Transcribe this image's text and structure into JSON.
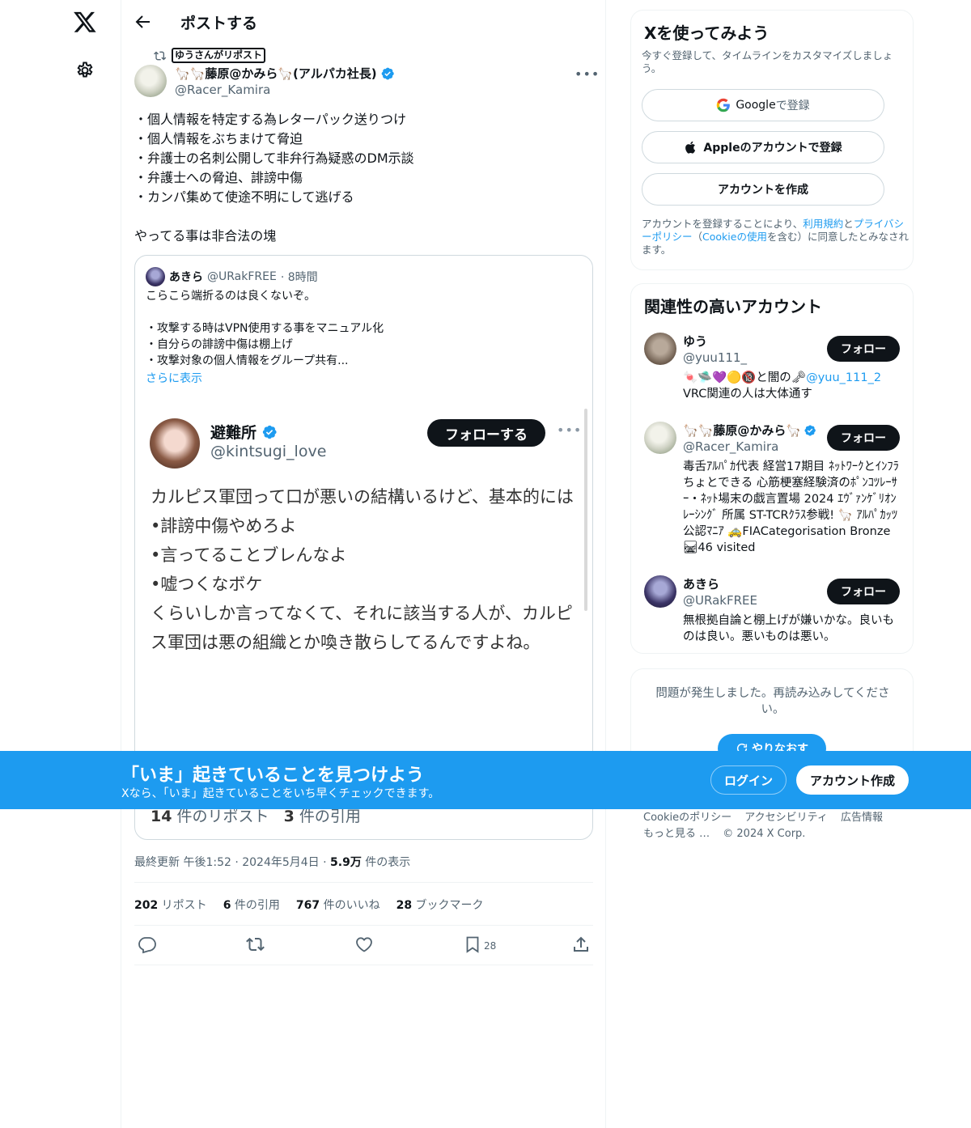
{
  "header": {
    "title": "ポストする"
  },
  "post": {
    "repost_label": "ゆうさんがリポスト",
    "author_name": "🦙🦙藤原@かみら🦙(アルパカ社長)",
    "author_handle": "@Racer_Kamira",
    "more": "•••",
    "body": "・個人情報を特定する為レターパック送りつけ\n・個人情報をぶちまけて脅迫\n・弁護士の名刺公開して非弁行為疑惑のDM示談\n・弁護士への脅迫、誹謗中傷\n・カンパ集めて使途不明にして逃げる\n\nやってる事は非合法の塊",
    "quote": {
      "name": "あきら",
      "handle": "@URakFREE",
      "time": "· 8時間",
      "text": "こらこら端折るのは良くないぞ。\n\n・攻撃する時はVPN使用する事をマニュアル化\n・自分らの誹謗中傷は棚上げ\n・攻撃対象の個人情報をグループ共有...",
      "show_more": "さらに表示",
      "image": {
        "name": "避難所",
        "handle": "@kintsugi_love",
        "follow": "フォローする",
        "dots": "•••",
        "text": "カルピス軍団って口が悪いの結構いるけど、基本的には\n•誹謗中傷やめろよ\n•言ってることブレんなよ\n•嘘つくなボケ\nくらいしか言ってなくて、それに該当する人が、カルピス軍団は悪の組織とか喚き散らしてるんですよね。",
        "reposts_num": "14",
        "reposts_label": " 件のリポスト",
        "quotes_num": "3",
        "quotes_label": " 件の引用"
      }
    },
    "meta_time": "最終更新 午後1:52 · 2024年5月4日 · ",
    "views_num": "5.9万",
    "views_label": " 件の表示",
    "stats": {
      "reposts_num": "202",
      "reposts_label": " リポスト",
      "quotes_num": "6",
      "quotes_label": " 件の引用",
      "likes_num": "767",
      "likes_label": " 件のいいね",
      "bookmarks_num": "28",
      "bookmarks_label": " ブックマーク"
    },
    "bookmark_count": "28"
  },
  "signup": {
    "title": "Xを使ってみよう",
    "subtitle": "今すぐ登録して、タイムラインをカスタマイズしましょう。",
    "google_brand": "Google",
    "google_label": " で登録",
    "apple": "Appleのアカウントで登録",
    "create": "アカウントを作成",
    "terms_a": "アカウントを登録することにより、",
    "terms_link1": "利用規約",
    "terms_b": "と",
    "terms_link2": "プライバシーポリシー",
    "terms_c": "（",
    "terms_link3": "Cookieの使用",
    "terms_d": "を含む）に同意したとみなされます。"
  },
  "related": {
    "title": "関連性の高いアカウント",
    "follow": "フォロー",
    "accounts": [
      {
        "name": "ゆう",
        "handle": "@yuu111_",
        "bio_a": "🍬🛸💜🟡🔞と闇の🗝",
        "bio_link": "@yuu_111_2",
        "bio_b": " VRC関連の人は大体通す"
      },
      {
        "name": "🦙🦙藤原@かみら🦙",
        "handle": "@Racer_Kamira",
        "bio_a": "毒舌ｱﾙﾊﾟｶ代表 経営17期目 ﾈｯﾄﾜｰｸとｲﾝﾌﾗちょとできる 心筋梗塞経験済のﾎﾟﾝｺﾂﾚｰｻｰ・ﾈｯﾄ場末の戯言置場 2024 ｴｳﾞｧﾝｹﾞﾘｵﾝ ﾚｰｼﾝｸﾞ 所属 ST-TCRｸﾗｽ参戦! 🦙 ｱﾙﾊﾟｶｯﾂ 公認ﾏﾆｱ 🚕FIACategorisation Bronze 🛤46 visited",
        "bio_link": "",
        "bio_b": ""
      },
      {
        "name": "あきら",
        "handle": "@URakFREE",
        "bio_a": "無根拠自論と棚上げが嫌いかな。良いものは良い。悪いものは悪い。",
        "bio_link": "",
        "bio_b": ""
      }
    ]
  },
  "error": {
    "text": "問題が発生しました。再読み込みしてください。",
    "retry": "やりなおす"
  },
  "footer": {
    "links": [
      "Cookieのポリシー",
      "アクセシビリティ",
      "広告情報",
      "もっと見る …",
      "© 2024 X Corp."
    ]
  },
  "banner": {
    "title": "「いま」起きていることを見つけよう",
    "subtitle": "Xなら、「いま」起きていることをいち早くチェックできます。",
    "login": "ログイン",
    "signup": "アカウント作成"
  },
  "colors": {
    "accent": "#1d9bf0",
    "text": "#0f1419",
    "muted": "#536471"
  }
}
